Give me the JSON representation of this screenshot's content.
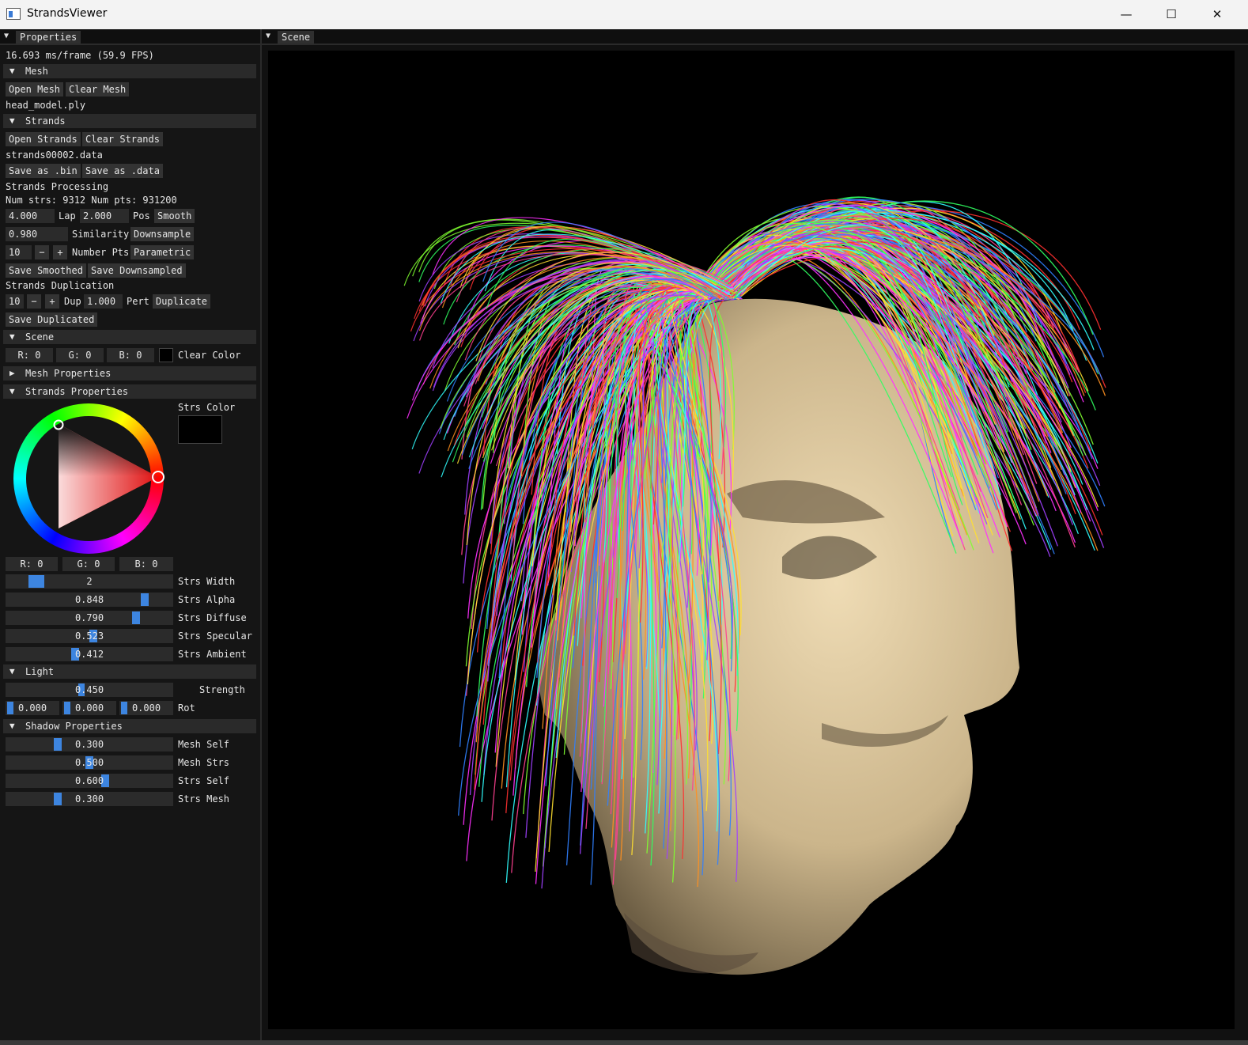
{
  "window": {
    "title": "StrandsViewer",
    "minimize": "—",
    "maximize": "☐",
    "close": "✕"
  },
  "properties": {
    "tab_label": "Properties",
    "fps": "16.693 ms/frame (59.9 FPS)",
    "mesh": {
      "header": "Mesh",
      "open": "Open Mesh",
      "clear": "Clear Mesh",
      "filename": "head_model.ply"
    },
    "strands": {
      "header": "Strands",
      "open": "Open Strands",
      "clear": "Clear Strands",
      "filename": "strands00002.data",
      "save_bin": "Save as .bin",
      "save_data": "Save as .data",
      "processing": "Strands Processing",
      "stats": "Num strs: 9312 Num pts: 931200",
      "lap_value": "4.000",
      "lap_label": "Lap",
      "pos_value": "2.000",
      "pos_label": "Pos",
      "smooth": "Smooth",
      "similarity_value": "0.980",
      "similarity_label": "Similarity",
      "downsample": "Downsample",
      "numpts_value": "10",
      "minus": "−",
      "plus": "+",
      "numpts_label": "Number Pts",
      "parametric": "Parametric",
      "save_smoothed": "Save Smoothed",
      "save_downsampled": "Save Downsampled",
      "duplication": "Strands Duplication",
      "dup_value": "10",
      "dup_label": "Dup",
      "pert_value": "1.000",
      "pert_label": "Pert",
      "duplicate": "Duplicate",
      "save_duplicated": "Save Duplicated"
    },
    "scene": {
      "header": "Scene",
      "r": "R:  0",
      "g": "G:  0",
      "b": "B:  0",
      "clear_color_label": "Clear Color",
      "clear_color": "#000000"
    },
    "mesh_properties": {
      "header": "Mesh Properties"
    },
    "strands_properties": {
      "header": "Strands Properties",
      "color_label": "Strs Color",
      "color": "#000000",
      "r": "R:  0",
      "g": "G:  0",
      "b": "B:  0",
      "sliders": [
        {
          "label": "Strs Width",
          "value": "2",
          "fraction": 0.15
        },
        {
          "label": "Strs Alpha",
          "value": "0.848",
          "fraction": 0.848
        },
        {
          "label": "Strs Diffuse",
          "value": "0.790",
          "fraction": 0.79
        },
        {
          "label": "Strs Specular",
          "value": "0.523",
          "fraction": 0.523
        },
        {
          "label": "Strs Ambient",
          "value": "0.412",
          "fraction": 0.412
        }
      ]
    },
    "light": {
      "header": "Light",
      "strength_value": "0.450",
      "strength_label": "Strength",
      "strength_fraction": 0.45,
      "rot": [
        "0.000",
        "0.000",
        "0.000"
      ],
      "rot_label": "Rot"
    },
    "shadow": {
      "header": "Shadow Properties",
      "sliders": [
        {
          "label": "Mesh Self",
          "value": "0.300",
          "fraction": 0.3
        },
        {
          "label": "Mesh Strs",
          "value": "0.500",
          "fraction": 0.5
        },
        {
          "label": "Strs Self",
          "value": "0.600",
          "fraction": 0.6
        },
        {
          "label": "Strs Mesh",
          "value": "0.300",
          "fraction": 0.3
        }
      ]
    }
  },
  "scene_view": {
    "tab_label": "Scene",
    "skin_color": "#d6c29d",
    "background": "#000000"
  }
}
